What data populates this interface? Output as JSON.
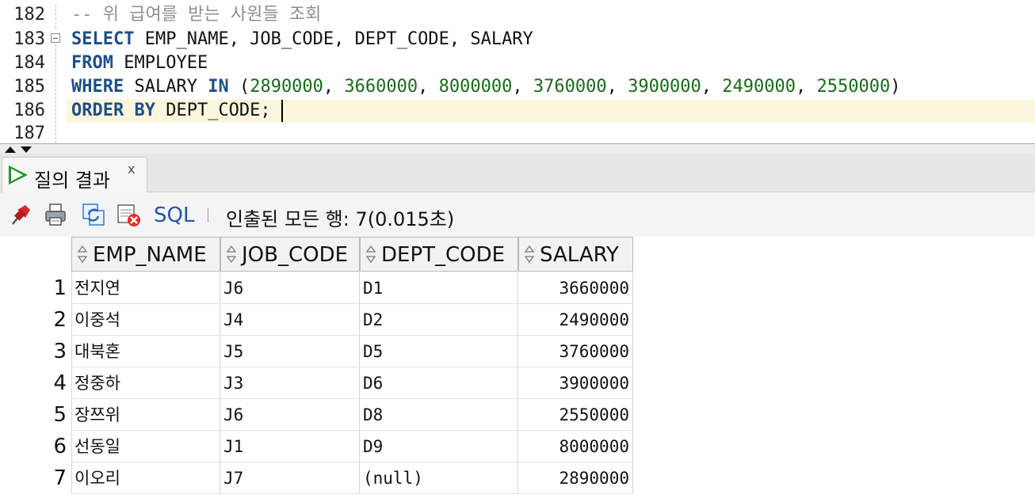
{
  "editor": {
    "line_numbers": [
      "182",
      "183",
      "184",
      "185",
      "186",
      "187"
    ],
    "lines": {
      "comment": "-- 위 급여를 받는 사원들 조회",
      "select_kw": "SELECT",
      "select_cols": " EMP_NAME, JOB_CODE, DEPT_CODE, SALARY",
      "from_kw": "FROM",
      "from_table": " EMPLOYEE",
      "where_kw": "WHERE",
      "where_col": " SALARY ",
      "in_kw": "IN",
      "open_paren": " (",
      "in_values": [
        "2890000",
        "3660000",
        "8000000",
        "3760000",
        "3900000",
        "2490000",
        "2550000"
      ],
      "close_paren": ")",
      "order_kw": "ORDER BY",
      "order_col": " DEPT_CODE;"
    }
  },
  "results_tab": {
    "label": "질의 결과",
    "close": "x"
  },
  "toolbar": {
    "icons": [
      "pin-icon",
      "print-icon",
      "refresh-icon",
      "export-delete-icon"
    ],
    "sql_label": "SQL",
    "separator": "|",
    "status": "인출된 모든 행: 7(0.015초)"
  },
  "grid": {
    "columns": [
      "EMP_NAME",
      "JOB_CODE",
      "DEPT_CODE",
      "SALARY"
    ],
    "rows": [
      {
        "n": "1",
        "EMP_NAME": "전지연",
        "JOB_CODE": "J6",
        "DEPT_CODE": "D1",
        "SALARY": "3660000"
      },
      {
        "n": "2",
        "EMP_NAME": "이중석",
        "JOB_CODE": "J4",
        "DEPT_CODE": "D2",
        "SALARY": "2490000"
      },
      {
        "n": "3",
        "EMP_NAME": "대북혼",
        "JOB_CODE": "J5",
        "DEPT_CODE": "D5",
        "SALARY": "3760000"
      },
      {
        "n": "4",
        "EMP_NAME": "정중하",
        "JOB_CODE": "J3",
        "DEPT_CODE": "D6",
        "SALARY": "3900000"
      },
      {
        "n": "5",
        "EMP_NAME": "장쯔위",
        "JOB_CODE": "J6",
        "DEPT_CODE": "D8",
        "SALARY": "2550000"
      },
      {
        "n": "6",
        "EMP_NAME": "선동일",
        "JOB_CODE": "J1",
        "DEPT_CODE": "D9",
        "SALARY": "8000000"
      },
      {
        "n": "7",
        "EMP_NAME": "이오리",
        "JOB_CODE": "J7",
        "DEPT_CODE": "(null)",
        "SALARY": "2890000"
      }
    ]
  },
  "colors": {
    "keyword": "#1f4f86",
    "number": "#176b17",
    "comment": "#8f8f8f",
    "current_line": "#fdf6df",
    "link": "#2255aa",
    "run_icon": "#1a9a2a"
  }
}
